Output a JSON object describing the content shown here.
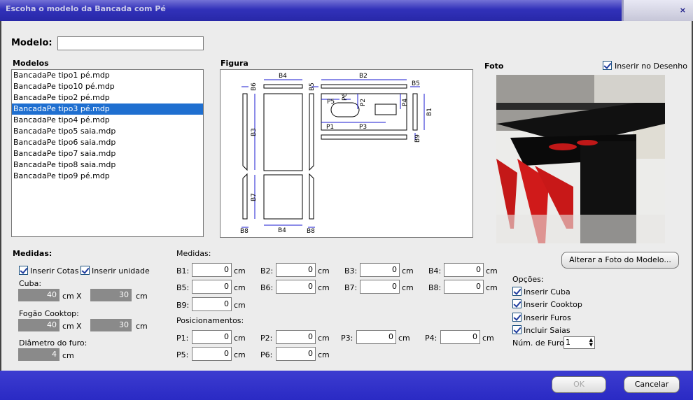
{
  "window": {
    "title": "Escoha o modelo da Bancada com Pé",
    "close": "×"
  },
  "modelo": {
    "label": "Modelo:",
    "value": ""
  },
  "modelos": {
    "label": "Modelos",
    "items": [
      "BancadaPe tipo1 pé.mdp",
      "BancadaPe tipo10 pé.mdp",
      "BancadaPe tipo2 pé.mdp",
      "BancadaPe tipo3 pé.mdp",
      "BancadaPe tipo4 pé.mdp",
      "BancadaPe tipo5 saia.mdp",
      "BancadaPe tipo6 saia.mdp",
      "BancadaPe tipo7 saia.mdp",
      "BancadaPe tipo8 saia.mdp",
      "BancadaPe tipo9 pé.mdp"
    ],
    "selected_index": 3
  },
  "figura": {
    "label": "Figura",
    "labels": {
      "B1": "B1",
      "B2": "B2",
      "B3": "B3",
      "B4": "B4",
      "B5": "B5",
      "B6": "B6",
      "B7": "B7",
      "B8": "B8",
      "B9": "B9",
      "P1": "P1",
      "P2": "P2",
      "P3": "P3",
      "P4": "P4",
      "P5": "P5",
      "P6": "P6"
    }
  },
  "foto": {
    "label": "Foto",
    "inserir_label": "Inserir no Desenho",
    "inserir_checked": true,
    "alterar_button": "Alterar a Foto do Modelo..."
  },
  "medidas_left": {
    "label": "Medidas:",
    "inserir_cotas": "Inserir Cotas",
    "inserir_unidade": "Inserir unidade",
    "cuba_label": "Cuba:",
    "cuba_w": "40",
    "cuba_h": "30",
    "fogao_label": "Fogão Cooktop:",
    "fogao_w": "40",
    "fogao_h": "30",
    "diametro_label": "Diâmetro do furo:",
    "diametro": "4",
    "cm": "cm",
    "x": "X"
  },
  "medidas": {
    "label": "Medidas:",
    "fields": [
      {
        "label": "B1:",
        "value": "0"
      },
      {
        "label": "B2:",
        "value": "0"
      },
      {
        "label": "B3:",
        "value": "0"
      },
      {
        "label": "B4:",
        "value": "0"
      },
      {
        "label": "B5:",
        "value": "0"
      },
      {
        "label": "B6:",
        "value": "0"
      },
      {
        "label": "B7:",
        "value": "0"
      },
      {
        "label": "B8:",
        "value": "0"
      },
      {
        "label": "B9:",
        "value": "0"
      }
    ]
  },
  "posicionamentos": {
    "label": "Posicionamentos:",
    "fields": [
      {
        "label": "P1:",
        "value": "0"
      },
      {
        "label": "P2:",
        "value": "0"
      },
      {
        "label": "P3:",
        "value": "0"
      },
      {
        "label": "P4:",
        "value": "0"
      },
      {
        "label": "P5:",
        "value": "0"
      },
      {
        "label": "P6:",
        "value": "0"
      }
    ]
  },
  "opcoes": {
    "label": "Opções:",
    "items": [
      "Inserir Cuba",
      "Inserir Cooktop",
      "Inserir Furos",
      "Incluir Saias"
    ],
    "num_furos_label": "Núm. de Furos:",
    "num_furos": "1"
  },
  "buttons": {
    "ok": "OK",
    "cancel": "Cancelar"
  },
  "colors": {
    "title_bar": "#3131b9",
    "selection": "#1f6fd0",
    "footer": "#2a2ac4",
    "dimension": "#1a1ad0"
  }
}
